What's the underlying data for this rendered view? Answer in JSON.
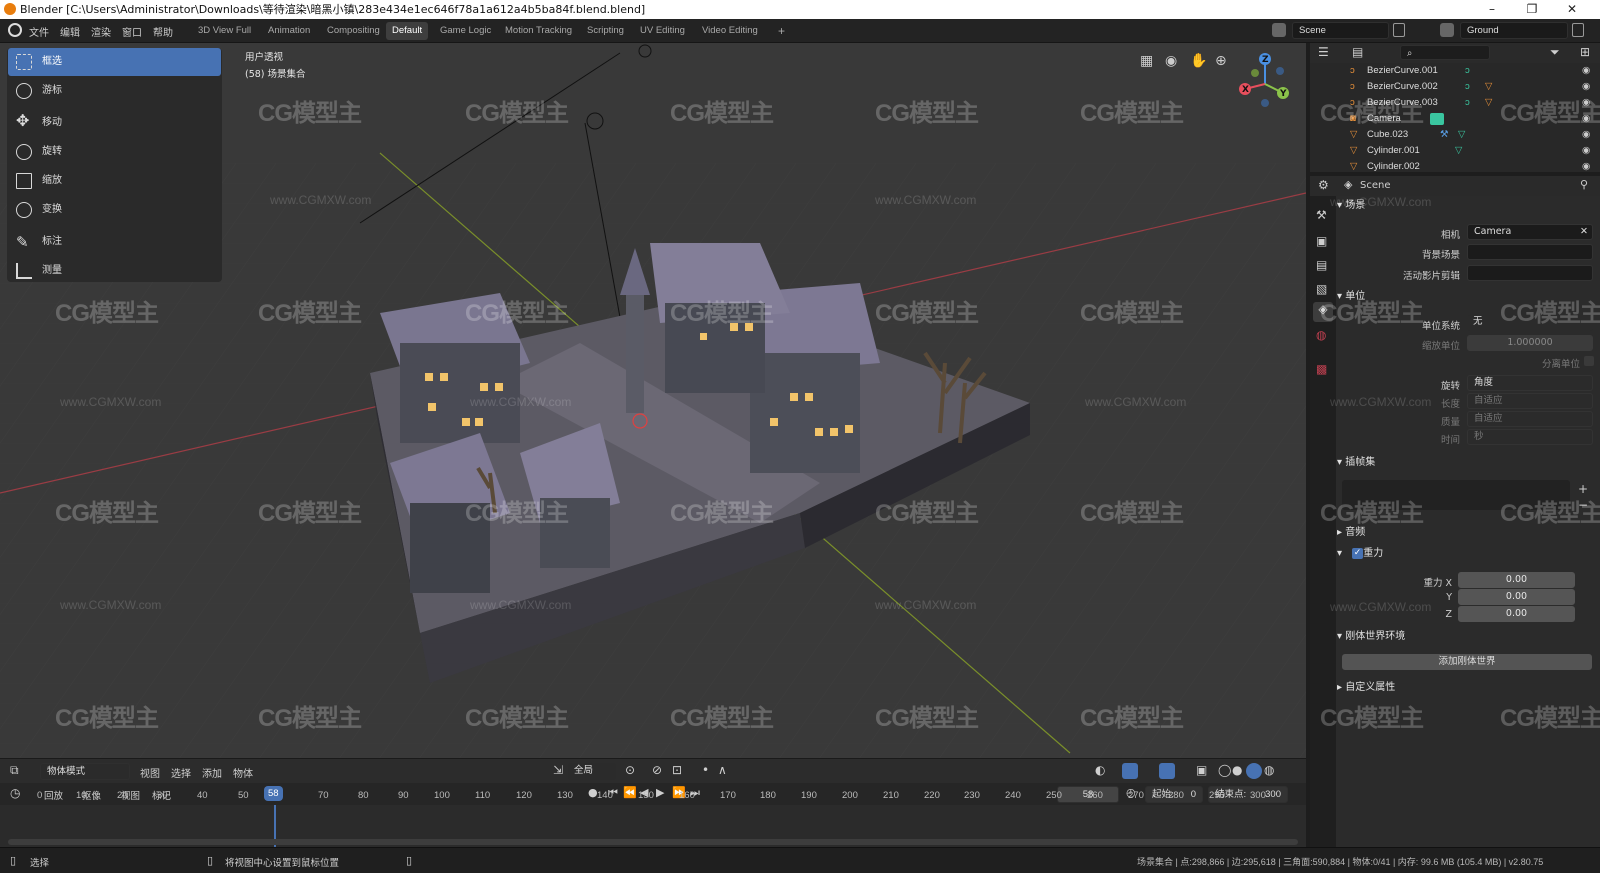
{
  "window": {
    "title": "Blender [C:\\Users\\Administrator\\Downloads\\等待渲染\\暗黑小镇\\283e434e1ec646f78a1a612a4b5ba84f.blend.blend]",
    "controls": [
      "–",
      "❐",
      "✕"
    ]
  },
  "menu": [
    "文件",
    "编辑",
    "渲染",
    "窗口",
    "帮助"
  ],
  "workspaces": [
    "3D View Full",
    "Animation",
    "Compositing",
    "Default",
    "Game Logic",
    "Motion Tracking",
    "Scripting",
    "UV Editing",
    "Video Editing"
  ],
  "active_workspace": "Default",
  "add_tab": "+",
  "scene_field": "Scene",
  "viewlayer_field": "Ground",
  "viewport": {
    "view_name": "用户透视",
    "collection": "(58) 场景集合",
    "gizmo_axes": [
      "X",
      "Y",
      "Z"
    ],
    "axis_colors": {
      "x": "#e84f5d",
      "y": "#8bc34a",
      "z": "#4a90e2"
    }
  },
  "tools": [
    {
      "label": "框选",
      "icon": "select-box-icon",
      "active": true
    },
    {
      "label": "游标",
      "icon": "cursor-icon"
    },
    {
      "label": "移动",
      "icon": "move-icon"
    },
    {
      "label": "旋转",
      "icon": "rotate-icon"
    },
    {
      "label": "缩放",
      "icon": "scale-icon"
    },
    {
      "label": "变换",
      "icon": "transform-icon"
    },
    {
      "label": "标注",
      "icon": "annotate-icon"
    },
    {
      "label": "测量",
      "icon": "measure-icon"
    }
  ],
  "viewport_header": {
    "mode": "物体模式",
    "menus": [
      "视图",
      "选择",
      "添加",
      "物体"
    ],
    "orientation": "全局"
  },
  "timeline": {
    "menus": [
      "回放",
      "抠像",
      "视图",
      "标记"
    ],
    "current_frame": "58",
    "start_label": "起始:",
    "start": "0",
    "end_label": "结束点:",
    "end": "300",
    "ticks": [
      "0",
      "10",
      "20",
      "30",
      "40",
      "50",
      "58",
      "70",
      "80",
      "90",
      "100",
      "110",
      "120",
      "130",
      "140",
      "150",
      "160",
      "170",
      "180",
      "190",
      "200",
      "210",
      "220",
      "230",
      "240",
      "250",
      "260",
      "270",
      "280",
      "290",
      "300"
    ]
  },
  "outliner": [
    {
      "name": "BezierCurve.001",
      "icon": "curve-icon"
    },
    {
      "name": "BezierCurve.002",
      "icon": "curve-icon"
    },
    {
      "name": "BezierCurve.003",
      "icon": "curve-icon"
    },
    {
      "name": "Camera",
      "icon": "camera-icon"
    },
    {
      "name": "Cube.023",
      "icon": "mesh-icon"
    },
    {
      "name": "Cylinder.001",
      "icon": "mesh-icon"
    },
    {
      "name": "Cylinder.002",
      "icon": "mesh-icon"
    }
  ],
  "properties": {
    "context": "Scene",
    "scene_section": "场景",
    "camera_label": "相机",
    "camera_value": "Camera",
    "bg_scene_label": "背景场景",
    "active_clip_label": "活动影片剪辑",
    "units_section": "单位",
    "unit_system_label": "单位系统",
    "unit_system_value": "无",
    "unit_scale_label": "缩放单位",
    "unit_scale_value": "1.000000",
    "separate_units_label": "分离单位",
    "rotation_label": "旋转",
    "rotation_value": "角度",
    "length_label": "长度",
    "length_value": "自适应",
    "mass_label": "质量",
    "mass_value": "自适应",
    "time_label": "时间",
    "time_value": "秒",
    "keying_section": "插帧集",
    "audio_section": "音频",
    "gravity_section": "重力",
    "gravity_x_label": "重力 X",
    "gravity_y_label": "Y",
    "gravity_z_label": "Z",
    "gravity_x": "0.00",
    "gravity_y": "0.00",
    "gravity_z": "0.00",
    "rigidbody_section": "刚体世界环境",
    "add_rigidbody_button": "添加刚体世界",
    "custom_props_section": "自定义属性"
  },
  "statusbar": {
    "left": "选择",
    "middle": "将视图中心设置到鼠标位置",
    "right": "场景集合 | 点:298,866 | 边:295,618 | 三角面:590,884 | 物体:0/41 | 内存: 99.6 MB (105.4 MB) | v2.80.75"
  },
  "watermark": {
    "logo": "CG模型主",
    "url": "www.CGMXW.com"
  },
  "colors": {
    "accent": "#4772b3",
    "active_frame": "#4772b3",
    "title_bar": "#ffffff"
  }
}
